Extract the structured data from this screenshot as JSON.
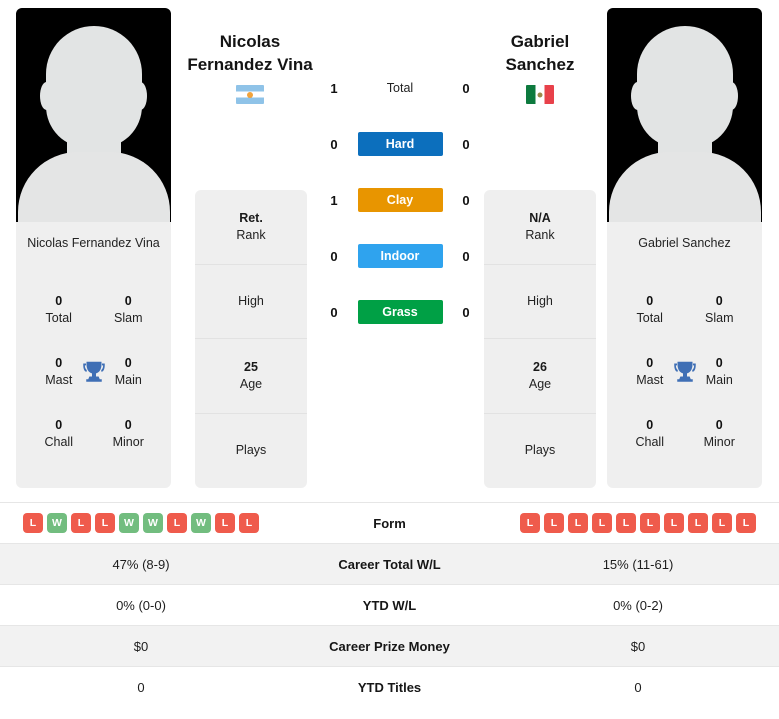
{
  "colors": {
    "hard": "#0c6fbd",
    "clay": "#e89500",
    "indoor": "#2fa3ee",
    "grass": "#00a045",
    "win": "#72bd7f",
    "loss": "#ef5b4c",
    "trophy": "#3f6fb5",
    "panel_bg": "#efefef",
    "row_shaded": "#f2f2f2"
  },
  "players": {
    "left": {
      "display_name_line1": "Nicolas",
      "display_name_line2": "Fernandez Vina",
      "card_name": "Nicolas Fernandez Vina",
      "flag": "argentina-flag",
      "titles": [
        {
          "value": "0",
          "label": "Total"
        },
        {
          "value": "0",
          "label": "Slam"
        },
        {
          "value": "0",
          "label": "Mast"
        },
        {
          "value": "0",
          "label": "Main"
        },
        {
          "value": "0",
          "label": "Chall"
        },
        {
          "value": "0",
          "label": "Minor"
        }
      ],
      "info": [
        {
          "value": "Ret.",
          "label": "Rank"
        },
        {
          "value": "",
          "label": "High"
        },
        {
          "value": "25",
          "label": "Age"
        },
        {
          "value": "",
          "label": "Plays"
        }
      ]
    },
    "right": {
      "display_name_line1": "Gabriel",
      "display_name_line2": "Sanchez",
      "card_name": "Gabriel Sanchez",
      "flag": "mexico-flag",
      "titles": [
        {
          "value": "0",
          "label": "Total"
        },
        {
          "value": "0",
          "label": "Slam"
        },
        {
          "value": "0",
          "label": "Mast"
        },
        {
          "value": "0",
          "label": "Main"
        },
        {
          "value": "0",
          "label": "Chall"
        },
        {
          "value": "0",
          "label": "Minor"
        }
      ],
      "info": [
        {
          "value": "N/A",
          "label": "Rank"
        },
        {
          "value": "",
          "label": "High"
        },
        {
          "value": "26",
          "label": "Age"
        },
        {
          "value": "",
          "label": "Plays"
        }
      ]
    }
  },
  "head_to_head": [
    {
      "surface": "Total",
      "left": "1",
      "right": "0",
      "badge": false
    },
    {
      "surface": "Hard",
      "left": "0",
      "right": "0",
      "badge": true
    },
    {
      "surface": "Clay",
      "left": "1",
      "right": "0",
      "badge": true
    },
    {
      "surface": "Indoor",
      "left": "0",
      "right": "0",
      "badge": true
    },
    {
      "surface": "Grass",
      "left": "0",
      "right": "0",
      "badge": true
    }
  ],
  "table": {
    "form_label": "Form",
    "form_left": [
      "L",
      "W",
      "L",
      "L",
      "W",
      "W",
      "L",
      "W",
      "L",
      "L"
    ],
    "form_right": [
      "L",
      "L",
      "L",
      "L",
      "L",
      "L",
      "L",
      "L",
      "L",
      "L"
    ],
    "rows": [
      {
        "label": "Career Total W/L",
        "left": "47% (8-9)",
        "right": "15% (11-61)"
      },
      {
        "label": "YTD W/L",
        "left": "0% (0-0)",
        "right": "0% (0-2)"
      },
      {
        "label": "Career Prize Money",
        "left": "$0",
        "right": "$0"
      },
      {
        "label": "YTD Titles",
        "left": "0",
        "right": "0"
      }
    ]
  }
}
